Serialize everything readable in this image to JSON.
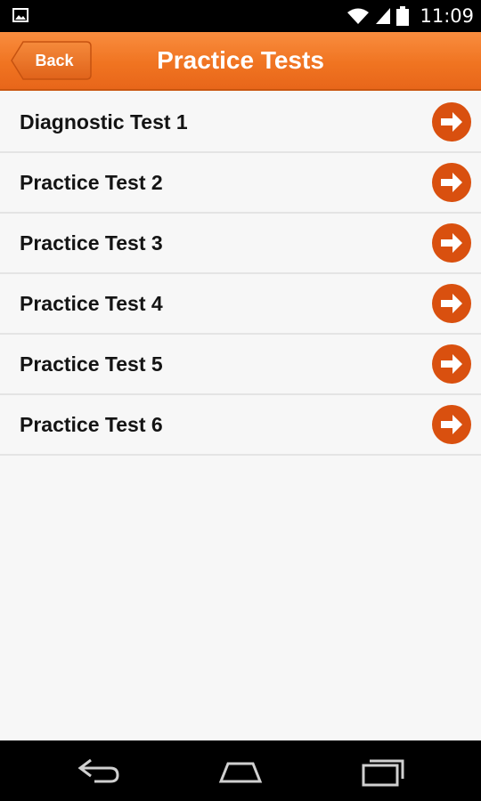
{
  "status_bar": {
    "time": "11:09",
    "icons": [
      "image-notification-icon",
      "wifi-icon",
      "cell-signal-icon",
      "battery-icon"
    ]
  },
  "header": {
    "back_label": "Back",
    "title": "Practice Tests",
    "accent_color": "#f07421"
  },
  "tests": [
    {
      "label": "Diagnostic Test 1",
      "icon": "arrow-right-icon"
    },
    {
      "label": "Practice Test 2",
      "icon": "arrow-right-icon"
    },
    {
      "label": "Practice Test 3",
      "icon": "arrow-right-icon"
    },
    {
      "label": "Practice Test 4",
      "icon": "arrow-right-icon"
    },
    {
      "label": "Practice Test 5",
      "icon": "arrow-right-icon"
    },
    {
      "label": "Practice Test 6",
      "icon": "arrow-right-icon"
    }
  ],
  "nav_bar": {
    "buttons": [
      "back-nav-icon",
      "home-nav-icon",
      "recents-nav-icon"
    ]
  }
}
